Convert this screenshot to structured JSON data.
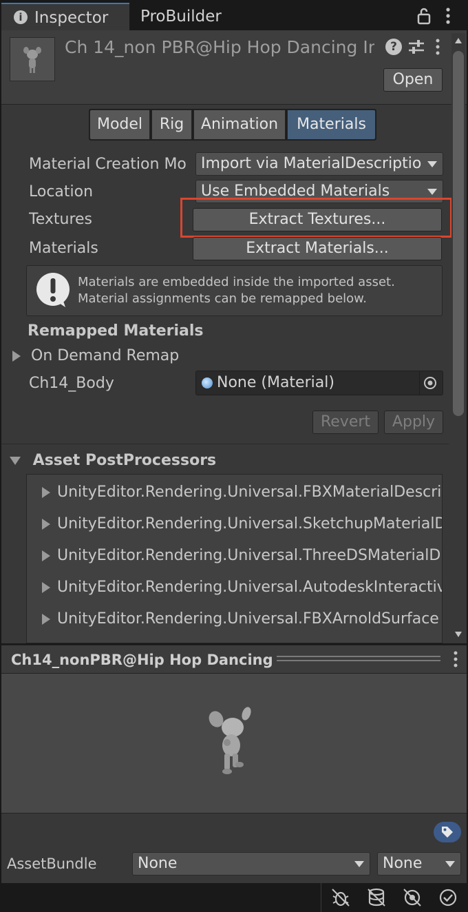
{
  "tabs": [
    {
      "label": "Inspector",
      "icon": "info-icon",
      "active": true
    },
    {
      "label": "ProBuilder",
      "active": false
    }
  ],
  "header": {
    "title": "Ch 14_non PBR@Hip Hop Dancing Im",
    "open_label": "Open"
  },
  "subtabs": [
    "Model",
    "Rig",
    "Animation",
    "Materials"
  ],
  "active_subtab": "Materials",
  "fields": {
    "material_creation_label": "Material Creation Mo",
    "material_creation_value": "Import via MaterialDescriptio",
    "location_label": "Location",
    "location_value": "Use Embedded Materials",
    "textures_label": "Textures",
    "extract_textures_label": "Extract Textures...",
    "materials_label": "Materials",
    "extract_materials_label": "Extract Materials..."
  },
  "info_box": {
    "line1": "Materials are embedded inside the imported asset.",
    "line2": "Material assignments can be remapped below."
  },
  "remapped": {
    "heading": "Remapped Materials",
    "on_demand_label": "On Demand Remap",
    "body_label": "Ch14_Body",
    "body_value": "None (Material)"
  },
  "actions": {
    "revert_label": "Revert",
    "apply_label": "Apply"
  },
  "postprocessors": {
    "heading": "Asset PostProcessors",
    "items": [
      "UnityEditor.Rendering.Universal.FBXMaterialDescri",
      "UnityEditor.Rendering.Universal.SketchupMaterialD",
      "UnityEditor.Rendering.Universal.ThreeDSMaterialD",
      "UnityEditor.Rendering.Universal.AutodeskInteractiv",
      "UnityEditor.Rendering.Universal.FBXArnoldSurface"
    ]
  },
  "preview": {
    "title": "Ch14_nonPBR@Hip Hop Dancing"
  },
  "assetbundle": {
    "label": "AssetBundle",
    "name_value": "None",
    "variant_value": "None"
  },
  "colors": {
    "highlight_box": "#d9462f",
    "active_tab": "#46607c",
    "accent": "#3a79bb"
  }
}
